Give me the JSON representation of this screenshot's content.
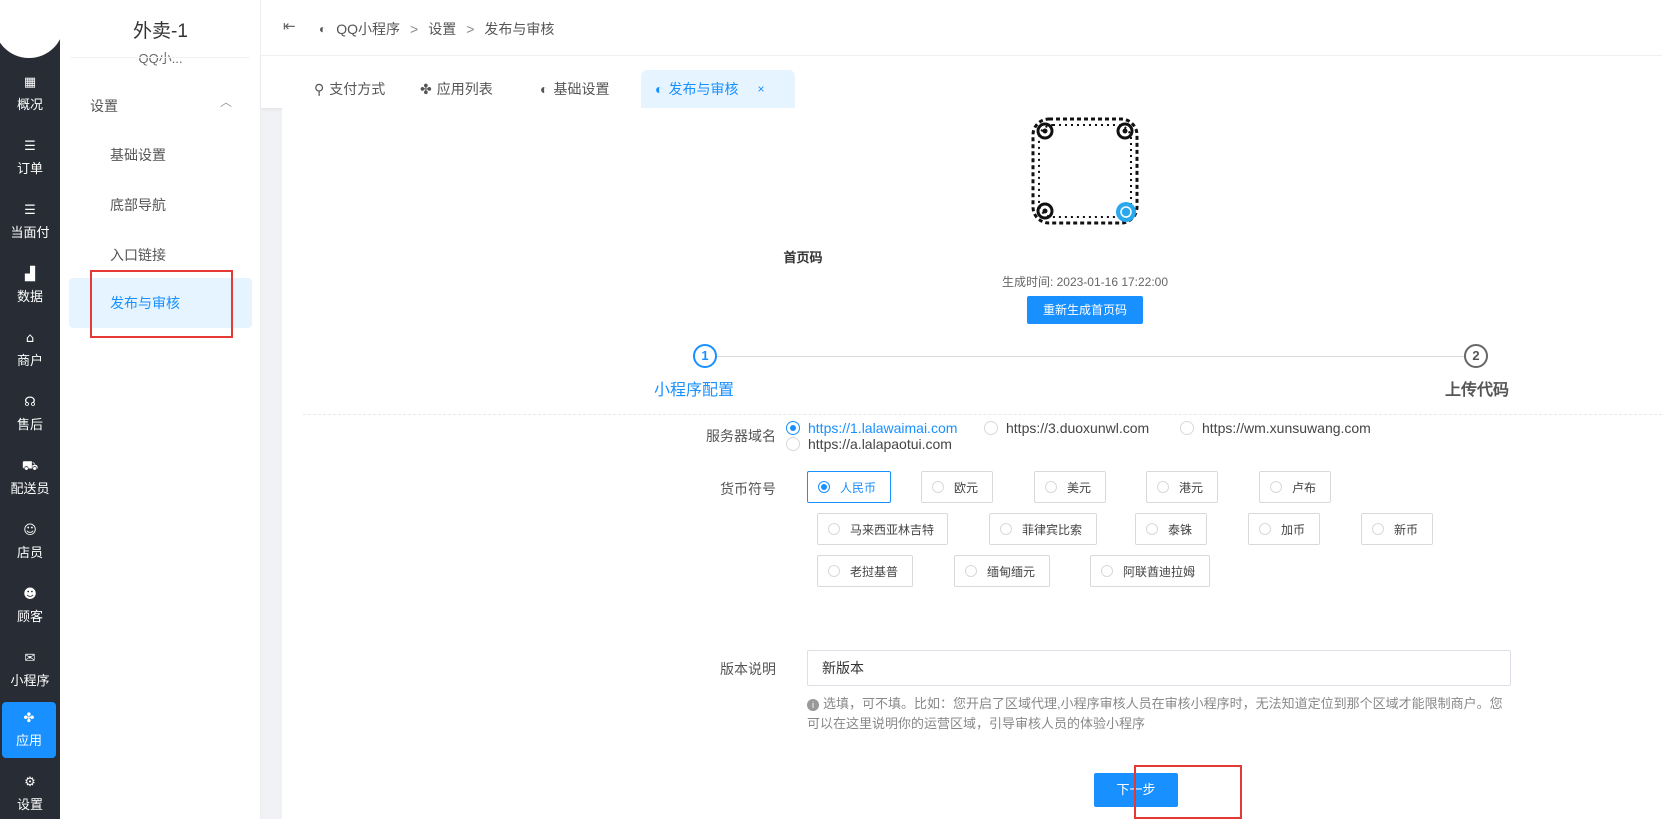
{
  "nav": {
    "items": [
      {
        "label": "概况",
        "icon": "dashboard-icon",
        "glyph": "▦"
      },
      {
        "label": "订单",
        "icon": "list-icon",
        "glyph": "☰"
      },
      {
        "label": "当面付",
        "icon": "list-icon",
        "glyph": "☰"
      },
      {
        "label": "数据",
        "icon": "bar-chart-icon",
        "glyph": "▟"
      },
      {
        "label": "商户",
        "icon": "store-icon",
        "glyph": "⌂"
      },
      {
        "label": "售后",
        "icon": "headset-icon",
        "glyph": "☊"
      },
      {
        "label": "配送员",
        "icon": "scooter-icon",
        "glyph": "⛟"
      },
      {
        "label": "店员",
        "icon": "users-icon",
        "glyph": "☺"
      },
      {
        "label": "顾客",
        "icon": "user-circle-icon",
        "glyph": "☻"
      },
      {
        "label": "小程序",
        "icon": "wechat-icon",
        "glyph": "✉"
      },
      {
        "label": "应用",
        "icon": "apps-icon",
        "glyph": "✤"
      },
      {
        "label": "设置",
        "icon": "settings-user-icon",
        "glyph": "⚙"
      }
    ]
  },
  "sidebar": {
    "title": "外卖-1",
    "subtitle": "QQ小...",
    "group_label": "设置",
    "items": [
      {
        "label": "基础设置"
      },
      {
        "label": "底部导航"
      },
      {
        "label": "入口链接"
      },
      {
        "label": "发布与审核"
      }
    ]
  },
  "header": {
    "collapse_glyph": "⇤",
    "breadcrumb": [
      "QQ小程序",
      "设置",
      "发布与审核"
    ],
    "separator": ">"
  },
  "tabs": [
    {
      "label": "支付方式",
      "icon": "user-icon"
    },
    {
      "label": "应用列表",
      "icon": "apps-icon"
    },
    {
      "label": "基础设置",
      "icon": "qq-icon"
    },
    {
      "label": "发布与审核",
      "icon": "qq-icon",
      "close": "×"
    }
  ],
  "qr": {
    "title": "首页码",
    "generated_time": "生成时间: 2023-01-16 17:22:00",
    "regen_label": "重新生成首页码"
  },
  "steps": [
    {
      "num": "1",
      "label": "小程序配置"
    },
    {
      "num": "2",
      "label": "上传代码"
    }
  ],
  "form": {
    "server_label": "服务器域名",
    "server_options": [
      {
        "label": "https://1.lalawaimai.com",
        "selected": true
      },
      {
        "label": "https://3.duoxunwl.com",
        "selected": false
      },
      {
        "label": "https://wm.xunsuwang.com",
        "selected": false
      },
      {
        "label": "https://a.lalapaotui.com",
        "selected": false
      }
    ],
    "currency_label": "货币符号",
    "currencies": [
      {
        "label": "人民币",
        "selected": true
      },
      {
        "label": "欧元"
      },
      {
        "label": "美元"
      },
      {
        "label": "港元"
      },
      {
        "label": "卢布"
      },
      {
        "label": "马来西亚林吉特"
      },
      {
        "label": "菲律宾比索"
      },
      {
        "label": "泰铢"
      },
      {
        "label": "加币"
      },
      {
        "label": "新币"
      },
      {
        "label": "老挝基普"
      },
      {
        "label": "缅甸缅元"
      },
      {
        "label": "阿联酋迪拉姆"
      }
    ],
    "version_label": "版本说明",
    "version_value": "新版本",
    "hint_icon": "i",
    "hint": "选填，可不填。比如：您开启了区域代理,小程序审核人员在审核小程序时，无法知道定位到那个区域才能限制商户。您可以在这里说明你的运营区域，引导审核人员的体验小程序",
    "next_label": "下一步"
  },
  "colors": {
    "accent": "#1890ff",
    "sidebar_bg": "#282c34",
    "highlight_border": "#e53935"
  }
}
